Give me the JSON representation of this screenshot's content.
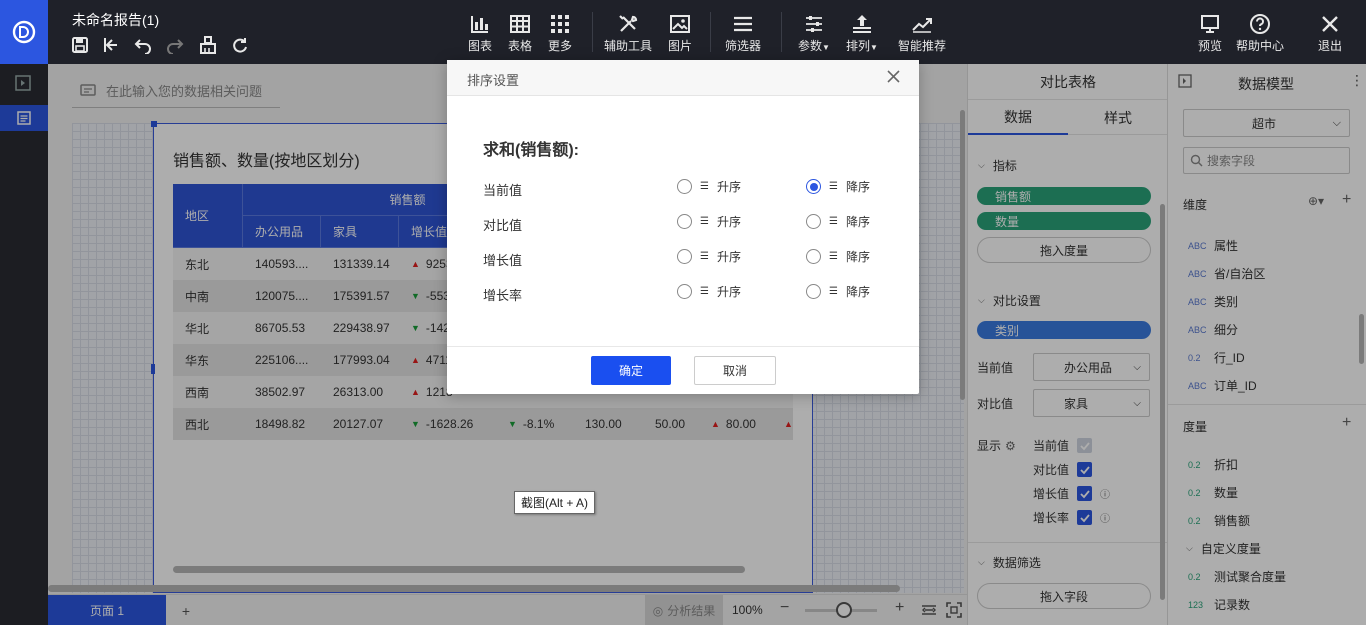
{
  "app": {
    "title": "未命名报告(1)"
  },
  "toolbar": {
    "chart": "图表",
    "table": "表格",
    "more": "更多",
    "aux": "辅助工具",
    "image": "图片",
    "filter": "筛选器",
    "params": "参数",
    "sort": "排列",
    "smart": "智能推荐",
    "preview": "预览",
    "help": "帮助中心",
    "exit": "退出"
  },
  "canvas": {
    "search_placeholder": "在此输入您的数据相关问题",
    "chart_title": "销售额、数量(按地区划分)",
    "table": {
      "h_region": "地区",
      "h_sales": "销售额",
      "h_office": "办公用品",
      "h_furniture": "家具",
      "h_growth": "增长值",
      "rows": [
        {
          "region": "东北",
          "office": "140593....",
          "furniture": "131339.14",
          "growth": "9253",
          "dir": "up"
        },
        {
          "region": "中南",
          "office": "120075....",
          "furniture": "175391.57",
          "growth": "-553",
          "dir": "down"
        },
        {
          "region": "华北",
          "office": "86705.53",
          "furniture": "229438.97",
          "growth": "-142",
          "dir": "down"
        },
        {
          "region": "华东",
          "office": "225106....",
          "furniture": "177993.04",
          "growth": "4711",
          "dir": "up"
        },
        {
          "region": "西南",
          "office": "38502.97",
          "furniture": "26313.00",
          "growth": "1218",
          "dir": "up"
        },
        {
          "region": "西北",
          "office": "18498.82",
          "furniture": "20127.07",
          "growth": "-1628.26",
          "dir": "down",
          "rate": "-8.1%",
          "c5": "130.00",
          "c6": "50.00",
          "c7": "80.00"
        }
      ]
    },
    "tooltip": "截图(Alt + A)"
  },
  "bottom": {
    "page_tab": "页面 1",
    "add": "+",
    "analysis": "分析结果",
    "zoom": "100%"
  },
  "panel_compare": {
    "title": "对比表格",
    "tab_data": "数据",
    "tab_style": "样式",
    "sec_metric": "指标",
    "metric_pills": [
      "销售额",
      "数量"
    ],
    "drop_measure": "拖入度量",
    "sec_compare": "对比设置",
    "compare_pill": "类别",
    "current_label": "当前值",
    "current_value": "办公用品",
    "compare_label": "对比值",
    "compare_value": "家具",
    "show_label": "显示",
    "show_items": [
      "当前值",
      "对比值",
      "增长值",
      "增长率"
    ],
    "sec_data_filter": "数据筛选",
    "drop_field": "拖入字段"
  },
  "panel_model": {
    "title": "数据模型",
    "dataset": "超市",
    "search_placeholder": "搜索字段",
    "dim_title": "维度",
    "dimensions": [
      {
        "type": "ABC",
        "name": "属性"
      },
      {
        "type": "ABC",
        "name": "省/自治区"
      },
      {
        "type": "ABC",
        "name": "类别"
      },
      {
        "type": "ABC",
        "name": "细分"
      },
      {
        "type": "0.2",
        "name": "行_ID"
      },
      {
        "type": "ABC",
        "name": "订单_ID"
      }
    ],
    "measure_title": "度量",
    "measures": [
      {
        "type": "0.2",
        "name": "折扣"
      },
      {
        "type": "0.2",
        "name": "数量"
      },
      {
        "type": "0.2",
        "name": "销售额"
      }
    ],
    "custom_group": "自定义度量",
    "custom_measures": [
      {
        "type": "0.2",
        "name": "测试聚合度量"
      },
      {
        "type": "123",
        "name": "记录数"
      }
    ]
  },
  "modal": {
    "title": "排序设置",
    "field": "求和(销售额):",
    "asc": "升序",
    "desc": "降序",
    "rows": [
      {
        "label": "当前值",
        "selected": "desc"
      },
      {
        "label": "对比值",
        "selected": ""
      },
      {
        "label": "增长值",
        "selected": ""
      },
      {
        "label": "增长率",
        "selected": ""
      }
    ],
    "ok": "确定",
    "cancel": "取消"
  },
  "colors": {
    "accent": "#2c56e0",
    "pill_green": "#2aa37a",
    "pill_blue": "#3a7be0",
    "topbar": "#1f2129"
  }
}
